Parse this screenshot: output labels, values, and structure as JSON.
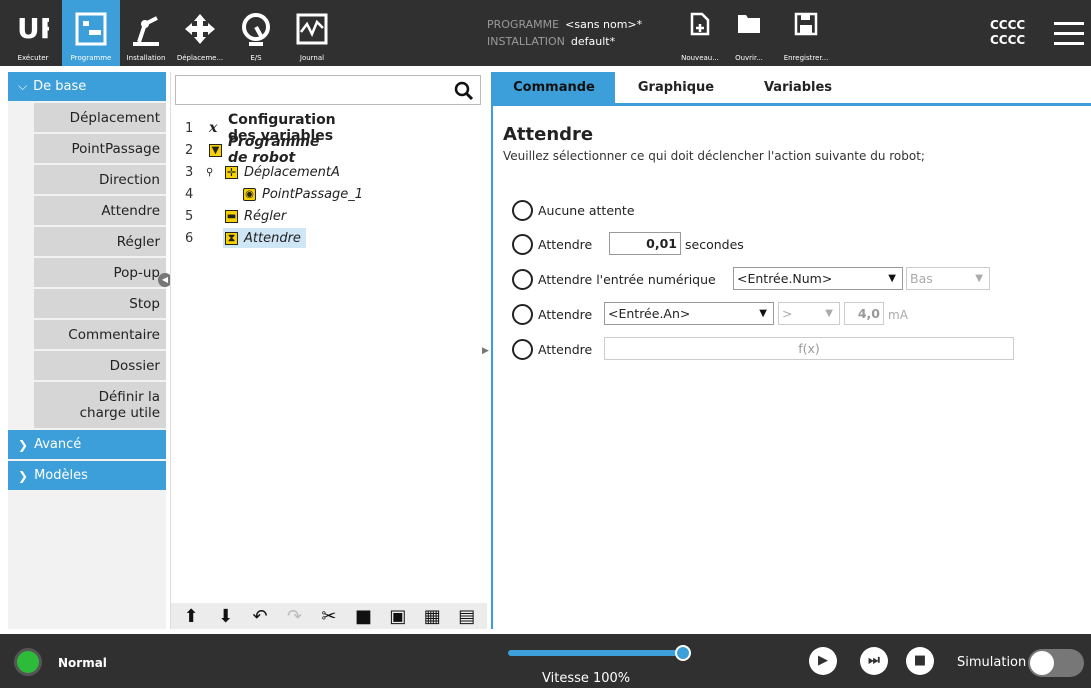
{
  "header": {
    "tabs": [
      {
        "label": "Exécuter"
      },
      {
        "label": "Programme"
      },
      {
        "label": "Installation"
      },
      {
        "label": "Déplaceme..."
      },
      {
        "label": "E/S"
      },
      {
        "label": "Journal"
      }
    ],
    "programme_key": "PROGRAMME",
    "programme_val": "<sans nom>*",
    "installation_key": "INSTALLATION",
    "installation_val": "default*",
    "file_buttons": [
      {
        "label": "Nouveau..."
      },
      {
        "label": "Ouvrir..."
      },
      {
        "label": "Enregistrer..."
      }
    ],
    "code_line1": "CCCC",
    "code_line2": "CCCC",
    "accent": "#3c9fd9"
  },
  "palette": {
    "basic_header": "De base",
    "items": [
      {
        "label": "Déplacement"
      },
      {
        "label": "PointPassage"
      },
      {
        "label": "Direction"
      },
      {
        "label": "Attendre"
      },
      {
        "label": "Régler"
      },
      {
        "label": "Pop-up"
      },
      {
        "label": "Stop"
      },
      {
        "label": "Commentaire"
      },
      {
        "label": "Dossier"
      },
      {
        "label": "Définir la charge utile"
      }
    ],
    "advanced_header": "Avancé",
    "templates_header": "Modèles"
  },
  "tree": {
    "rows": [
      {
        "num": "1",
        "label": "Configuration des variables"
      },
      {
        "num": "2",
        "label": "Programme de robot"
      },
      {
        "num": "3",
        "label": "DéplacementA"
      },
      {
        "num": "4",
        "label": "PointPassage_1"
      },
      {
        "num": "5",
        "label": "Régler"
      },
      {
        "num": "6",
        "label": "Attendre"
      }
    ]
  },
  "right": {
    "tabs": [
      {
        "label": "Commande"
      },
      {
        "label": "Graphique"
      },
      {
        "label": "Variables"
      }
    ],
    "title": "Attendre",
    "subtitle": "Veuillez sélectionner ce qui doit déclencher l'action suivante du robot;",
    "opt1": "Aucune attente",
    "opt2": "Attendre",
    "opt2_value": "0,01",
    "opt2_unit": "secondes",
    "opt3": "Attendre l'entrée numérique",
    "opt3_dd": "<Entrée.Num>",
    "opt3_state": "Bas",
    "opt4": "Attendre",
    "opt4_dd": "<Entrée.An>",
    "opt4_op": ">",
    "opt4_value": "4,0",
    "opt4_unit": "mA",
    "opt5": "Attendre",
    "opt5_fx": "f(x)"
  },
  "footer": {
    "status": "Normal",
    "speed_label": "Vitesse 100%",
    "speed_fraction": 1.0,
    "sim_label": "Simulation"
  }
}
